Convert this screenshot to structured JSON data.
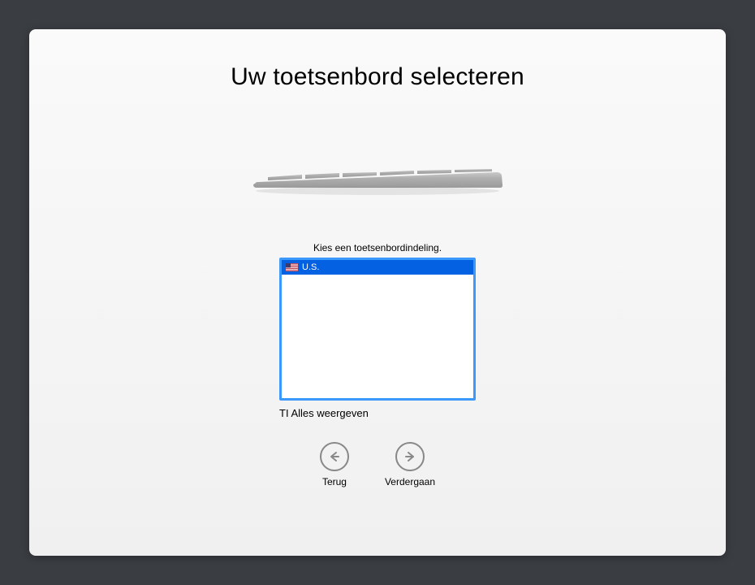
{
  "title": "Uw toetsenbord selecteren",
  "instruction": "Kies een toetsenbordindeling.",
  "layouts": [
    {
      "label": "U.S.",
      "flag": "us",
      "selected": true
    }
  ],
  "show_all_label": "TI Alles weergeven",
  "nav": {
    "back_label": "Terug",
    "continue_label": "Verdergaan"
  }
}
